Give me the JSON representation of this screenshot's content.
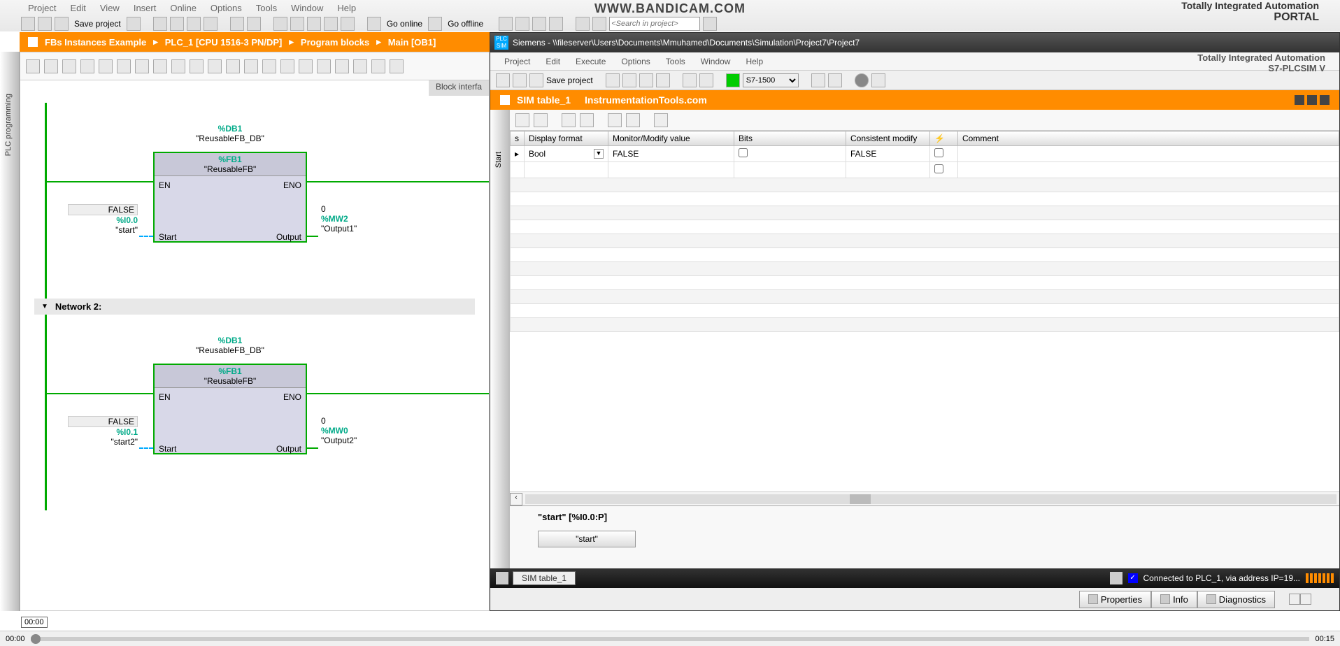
{
  "app": {
    "watermark": "WWW.BANDICAM.COM",
    "tia_line1": "Totally Integrated Automation",
    "tia_line2": "PORTAL"
  },
  "menu1": [
    "Project",
    "Edit",
    "View",
    "Insert",
    "Online",
    "Options",
    "Tools",
    "Window",
    "Help"
  ],
  "toolbar1": {
    "save": "Save project",
    "go_online": "Go online",
    "go_offline": "Go offline",
    "search_placeholder": "<Search in project>"
  },
  "breadcrumb": {
    "items": [
      "FBs Instances Example",
      "PLC_1 [CPU 1516-3 PN/DP]",
      "Program blocks",
      "Main [OB1]"
    ]
  },
  "block_interface": "Block interfa",
  "left_rail": "PLC programming",
  "network1": {
    "db_code": "%DB1",
    "db_name": "\"ReusableFB_DB\"",
    "fb_code": "%FB1",
    "fb_name": "\"ReusableFB\"",
    "en": "EN",
    "eno": "ENO",
    "start_port": "Start",
    "output_port": "Output",
    "input_val": "FALSE",
    "input_addr": "%I0.0",
    "input_name": "\"start\"",
    "out_val": "0",
    "out_addr": "%MW2",
    "out_name": "\"Output1\""
  },
  "network2": {
    "title": "Network 2:",
    "db_code": "%DB1",
    "db_name": "\"ReusableFB_DB\"",
    "fb_code": "%FB1",
    "fb_name": "\"ReusableFB\"",
    "en": "EN",
    "eno": "ENO",
    "start_port": "Start",
    "output_port": "Output",
    "input_val": "FALSE",
    "input_addr": "%I0.1",
    "input_name": "\"start2\"",
    "out_val": "0",
    "out_addr": "%MW0",
    "out_name": "\"Output2\""
  },
  "sim": {
    "title_prefix": "Siemens  -  \\\\fileserver\\Users\\Documents\\Mmuhamed\\Documents\\Simulation\\Project7\\Project7",
    "menu": [
      "Project",
      "Edit",
      "Execute",
      "Options",
      "Tools",
      "Window",
      "Help"
    ],
    "tia1": "Totally Integrated Automation",
    "tia2": "S7-PLCSIM V",
    "save": "Save project",
    "cpu_select": "S7-1500",
    "tab_name": "SIM table_1",
    "tab_site": "InstrumentationTools.com",
    "left_rail": "Start",
    "columns": [
      "s",
      "Display format",
      "Monitor/Modify value",
      "Bits",
      "Consistent modify",
      "",
      "Comment"
    ],
    "row1": {
      "format": "Bool",
      "monitor": "FALSE",
      "consistent": "FALSE"
    },
    "footer_tag": "\"start\" [%I0.0:P]",
    "footer_btn": "\"start\"",
    "status_tab": "SIM table_1",
    "status_conn": "Connected to PLC_1, via address IP=19...",
    "bottom_tabs": [
      "Properties",
      "Info",
      "Diagnostics"
    ]
  },
  "video": {
    "overlay": "00:00",
    "time_l": "00:00",
    "time_r": "00:15"
  }
}
